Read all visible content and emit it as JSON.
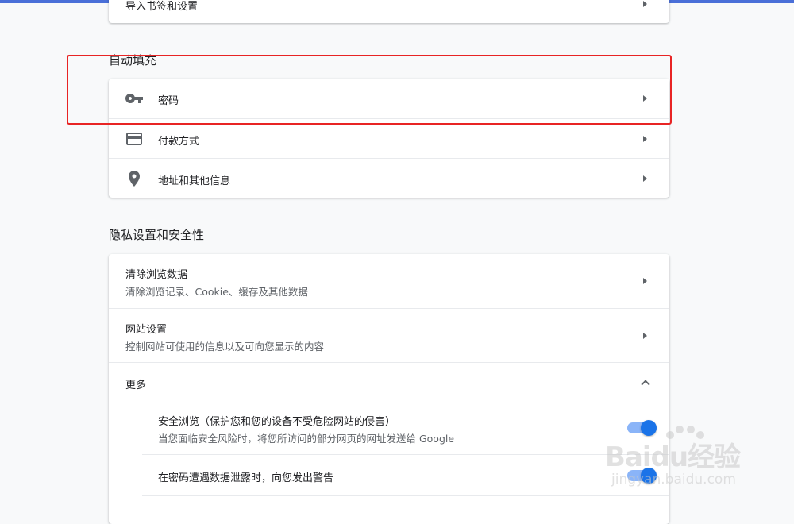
{
  "colors": {
    "accent": "#1a73e8",
    "toggle_track": "#8ab4f8",
    "highlight": "#e82424",
    "topbar": "#4a6fd8"
  },
  "top_card": {
    "partial_label": "导入书签和设置"
  },
  "autofill": {
    "section_title": "自动填充",
    "items": [
      {
        "label": "密码",
        "icon": "key-icon"
      },
      {
        "label": "付款方式",
        "icon": "credit-card-icon"
      },
      {
        "label": "地址和其他信息",
        "icon": "location-pin-icon"
      }
    ]
  },
  "privacy": {
    "section_title": "隐私设置和安全性",
    "items": [
      {
        "title": "清除浏览数据",
        "subtitle": "清除浏览记录、Cookie、缓存及其他数据"
      },
      {
        "title": "网站设置",
        "subtitle": "控制网站可使用的信息以及可向您显示的内容"
      }
    ],
    "more": {
      "label": "更多",
      "options": [
        {
          "title": "安全浏览（保护您和您的设备不受危险网站的侵害）",
          "subtitle": "当您面临安全风险时，将您所访问的部分网页的网址发送给 Google",
          "enabled": true
        },
        {
          "title": "在密码遭遇数据泄露时，向您发出警告",
          "enabled": true
        }
      ]
    }
  },
  "watermark": {
    "text": "Baidu经验",
    "url": "jingyan.baidu.com"
  }
}
